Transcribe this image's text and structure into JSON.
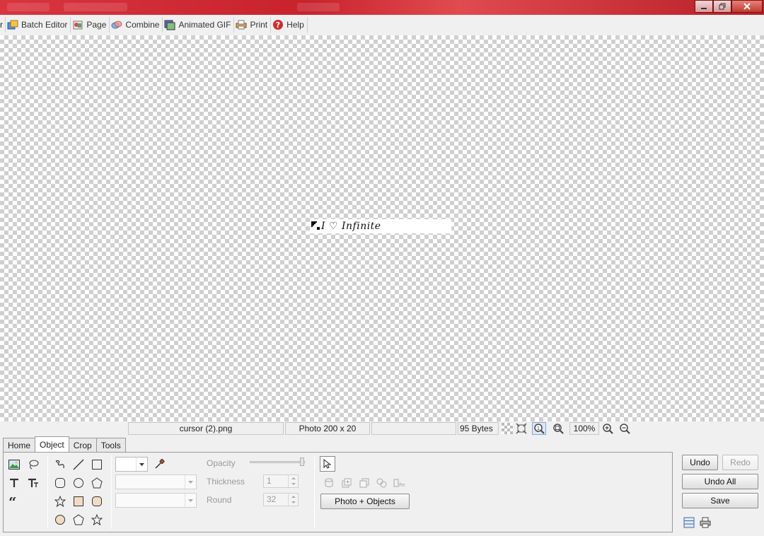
{
  "menu": {
    "cut_label": "r",
    "items": [
      {
        "label": "Batch Editor",
        "icon": "batch-editor-icon"
      },
      {
        "label": "Page",
        "icon": "page-icon"
      },
      {
        "label": "Combine",
        "icon": "combine-icon"
      },
      {
        "label": "Animated GIF",
        "icon": "animated-gif-icon"
      },
      {
        "label": "Print",
        "icon": "print-icon"
      },
      {
        "label": "Help",
        "icon": "help-icon"
      }
    ]
  },
  "canvas": {
    "image_text": "I ♡ Infinite"
  },
  "status": {
    "filename": "cursor (2).png",
    "dimensions": "Photo 200 x 20",
    "empty": "",
    "size": "95 Bytes",
    "zoom": "100%"
  },
  "tabs": [
    {
      "label": "Home",
      "active": false
    },
    {
      "label": "Object",
      "active": true
    },
    {
      "label": "Crop",
      "active": false
    },
    {
      "label": "Tools",
      "active": false
    }
  ],
  "object_panel": {
    "opacity_label": "Opacity",
    "thickness_label": "Thickness",
    "thickness_value": "1",
    "round_label": "Round",
    "round_value": "32",
    "photo_objects_button": "Photo + Objects",
    "opacity_value": 1.0
  },
  "actions": {
    "undo": "Undo",
    "redo": "Redo",
    "undo_all": "Undo All",
    "save": "Save"
  },
  "colors": {
    "titlebar": "#c8232c",
    "checker": "#cfcfcf"
  }
}
